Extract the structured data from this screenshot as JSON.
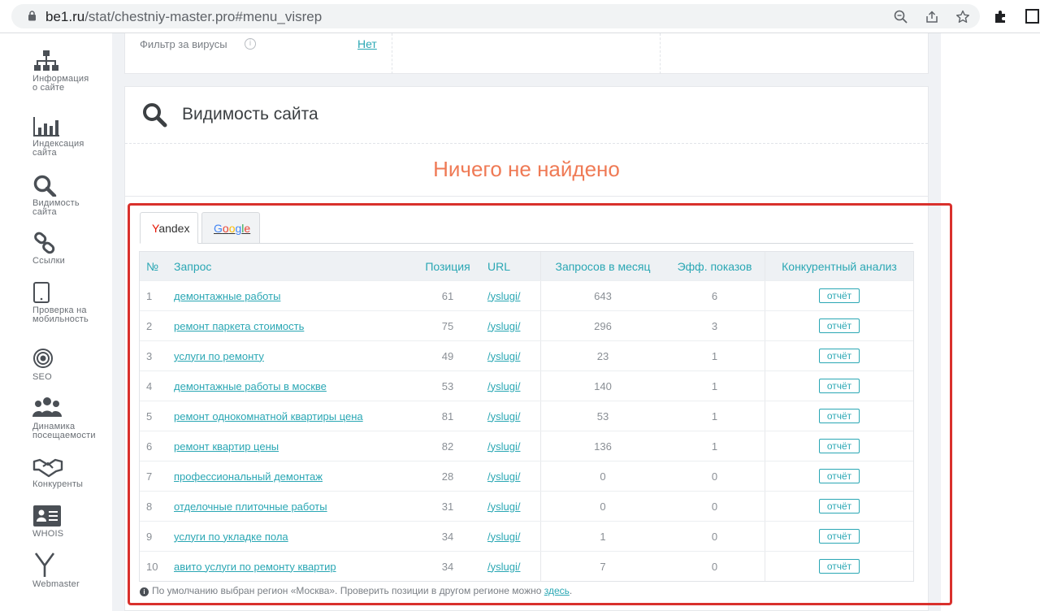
{
  "browser": {
    "url_host": "be1.ru",
    "url_path": "/stat/chestniy-master.pro#menu_visrep"
  },
  "sidebar": {
    "items": [
      {
        "label": "Информация о сайте",
        "icon": "sitemap-icon"
      },
      {
        "label": "Индексация сайта",
        "icon": "bar-chart-icon"
      },
      {
        "label": "Видимость сайта",
        "icon": "search-icon"
      },
      {
        "label": "Ссылки",
        "icon": "link-icon"
      },
      {
        "label": "Проверка на мобильность",
        "icon": "tablet-icon"
      },
      {
        "label": "SEO",
        "icon": "target-icon"
      },
      {
        "label": "Динамика посещаемости",
        "icon": "users-icon"
      },
      {
        "label": "Конкуренты",
        "icon": "handshake-icon"
      },
      {
        "label": "WHOIS",
        "icon": "id-card-icon"
      },
      {
        "label": "Webmaster",
        "icon": "yandex-icon"
      }
    ]
  },
  "filter": {
    "label": "Фильтр за вирусы",
    "value": "Нет"
  },
  "visibility": {
    "title": "Видимость сайта",
    "nothing_found": "Ничего не найдено"
  },
  "tabs": {
    "yandex": "Yandex",
    "google": "Google"
  },
  "table": {
    "headers": {
      "num": "№",
      "query": "Запрос",
      "position": "Позиция",
      "url": "URL",
      "requests": "Запросов в месяц",
      "eff": "Эфф. показов",
      "competitive": "Конкурентный анализ"
    },
    "report_label": "отчёт",
    "rows": [
      {
        "n": "1",
        "q": "демонтажные работы",
        "p": "61",
        "u": "/yslugi/",
        "m": "643",
        "e": "6"
      },
      {
        "n": "2",
        "q": "ремонт паркета стоимость",
        "p": "75",
        "u": "/yslugi/",
        "m": "296",
        "e": "3"
      },
      {
        "n": "3",
        "q": "услуги по ремонту",
        "p": "49",
        "u": "/yslugi/",
        "m": "23",
        "e": "1"
      },
      {
        "n": "4",
        "q": "демонтажные работы в москве",
        "p": "53",
        "u": "/yslugi/",
        "m": "140",
        "e": "1"
      },
      {
        "n": "5",
        "q": "ремонт однокомнатной квартиры цена",
        "p": "81",
        "u": "/yslugi/",
        "m": "53",
        "e": "1"
      },
      {
        "n": "6",
        "q": "ремонт квартир цены",
        "p": "82",
        "u": "/yslugi/",
        "m": "136",
        "e": "1"
      },
      {
        "n": "7",
        "q": "профессиональный демонтаж",
        "p": "28",
        "u": "/yslugi/",
        "m": "0",
        "e": "0"
      },
      {
        "n": "8",
        "q": "отделочные плиточные работы",
        "p": "31",
        "u": "/yslugi/",
        "m": "0",
        "e": "0"
      },
      {
        "n": "9",
        "q": "услуги по укладке пола",
        "p": "34",
        "u": "/yslugi/",
        "m": "1",
        "e": "0"
      },
      {
        "n": "10",
        "q": "авито услуги по ремонту квартир",
        "p": "34",
        "u": "/yslugi/",
        "m": "7",
        "e": "0"
      }
    ]
  },
  "note": {
    "text": "По умолчанию выбран регион «Москва». Проверить позиции в другом регионе можно",
    "link": "здесь",
    "end": "."
  },
  "colors": {
    "accent": "#2aa7b4",
    "nothing_found": "#ef7a55",
    "highlight": "#d9302c"
  }
}
